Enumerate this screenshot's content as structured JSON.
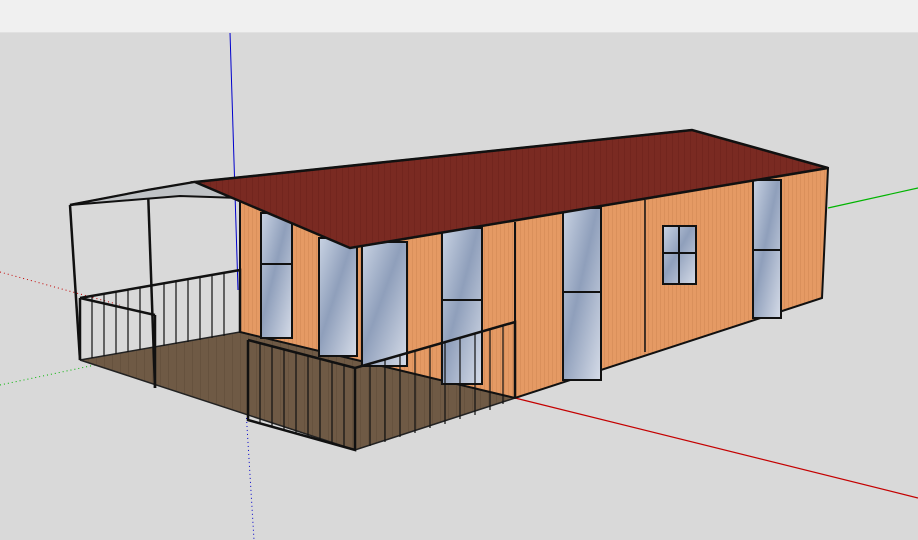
{
  "app": {
    "toolbar": {},
    "viewport": {
      "background": "#d9d9d9",
      "axis_colors": {
        "red": "#c40000",
        "green": "#00b400",
        "blue": "#0000cc"
      },
      "model": {
        "roof_color": "#7a2a22",
        "wall_color": "#e59a64",
        "deck_color": "#6f5a45",
        "glass_color": "#aab7cc"
      }
    }
  }
}
